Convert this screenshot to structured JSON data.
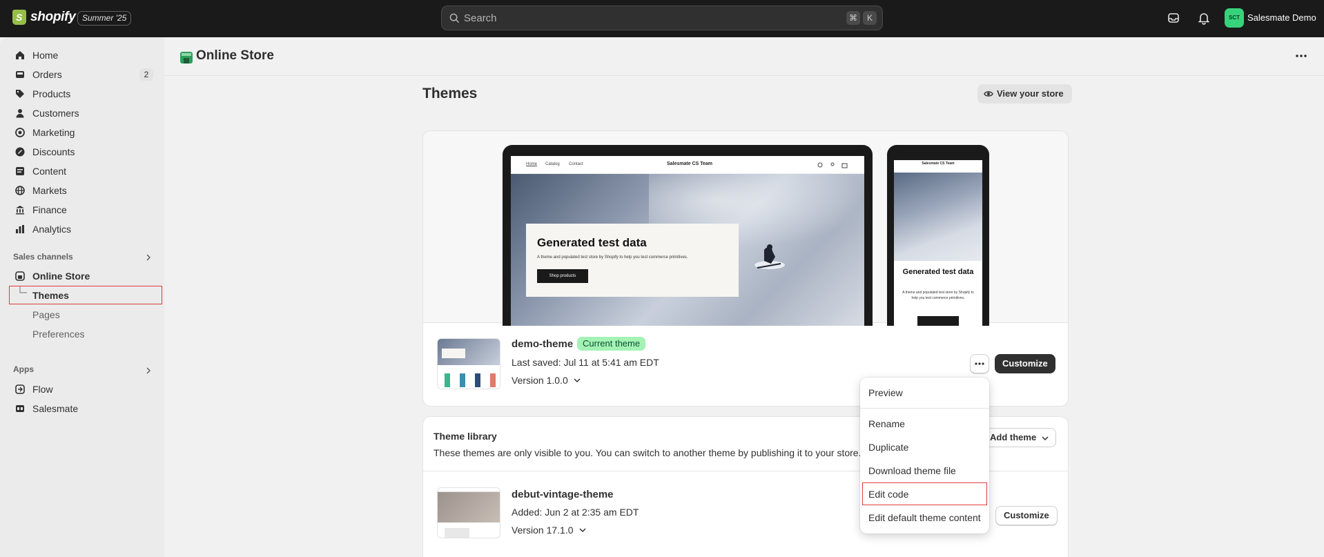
{
  "topbar": {
    "logo_text": "shopify",
    "edition": "Summer '25",
    "search_placeholder": "Search",
    "kbd_cmd": "⌘",
    "kbd_k": "K",
    "avatar_initials": "SCT",
    "store_name": "Salesmate Demo"
  },
  "sidebar": {
    "items": [
      {
        "label": "Home"
      },
      {
        "label": "Orders",
        "badge": "2"
      },
      {
        "label": "Products"
      },
      {
        "label": "Customers"
      },
      {
        "label": "Marketing"
      },
      {
        "label": "Discounts"
      },
      {
        "label": "Content"
      },
      {
        "label": "Markets"
      },
      {
        "label": "Finance"
      },
      {
        "label": "Analytics"
      }
    ],
    "sales_channels_title": "Sales channels",
    "online_store": "Online Store",
    "online_store_sub": [
      {
        "label": "Themes"
      },
      {
        "label": "Pages"
      },
      {
        "label": "Preferences"
      }
    ],
    "apps_title": "Apps",
    "apps": [
      {
        "label": "Flow"
      },
      {
        "label": "Salesmate"
      }
    ]
  },
  "header": {
    "title": "Online Store"
  },
  "themes": {
    "title": "Themes",
    "view_store": "View your store",
    "preview": {
      "nav_home": "Home",
      "nav_catalog": "Catalog",
      "nav_contact": "Contact",
      "brand": "Salesmate CS Team",
      "hero_title": "Generated test data",
      "hero_sub": "A theme and populated test store by Shopify to help you test commerce primitives.",
      "hero_button": "Shop products",
      "phone_brand": "Salesmate CS Team",
      "phone_title": "Generated test data",
      "phone_sub": "A theme and populated test store by Shopify to help you test commerce primitives."
    },
    "current": {
      "name": "demo-theme",
      "badge": "Current theme",
      "meta": "Last saved: Jul 11 at 5:41 am EDT",
      "version": "Version 1.0.0",
      "customize": "Customize"
    },
    "library": {
      "title": "Theme library",
      "description": "These themes are only visible to you. You can switch to another theme by publishing it to your store.",
      "add_theme": "Add theme",
      "themes": [
        {
          "name": "debut-vintage-theme",
          "meta": "Added: Jun 2 at 2:35 am EDT",
          "version": "Version 17.1.0",
          "customize": "Customize"
        }
      ]
    }
  },
  "popover": {
    "items": [
      "Preview",
      "Rename",
      "Duplicate",
      "Download theme file",
      "Edit code",
      "Edit default theme content"
    ]
  },
  "colors": {
    "topbar": "#1a1a1a",
    "accent_green": "#a4f2b4",
    "highlight": "#e03b3b"
  }
}
